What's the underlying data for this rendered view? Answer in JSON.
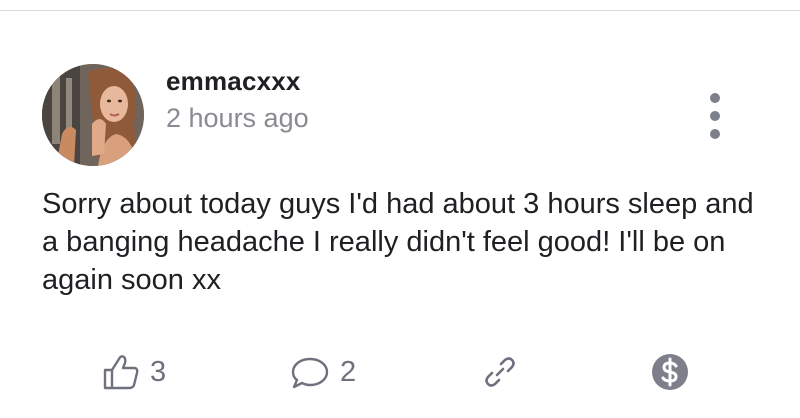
{
  "post": {
    "author": "emmacxxx",
    "time": "2 hours ago",
    "text": "Sorry about today guys I'd had about 3 hours sleep and a banging headache I really didn't feel good! I'll be on again soon xx"
  },
  "actions": {
    "likes": "3",
    "comments": "2"
  },
  "icons": {
    "avatar": "profile-photo",
    "more": "vertical-ellipsis-icon",
    "like": "thumbs-up-icon",
    "comment": "speech-bubble-icon",
    "share": "link-icon",
    "tip": "dollar-coin-icon"
  },
  "colors": {
    "text": "#1f1f24",
    "muted": "#8a8a93",
    "icon": "#6f717c",
    "tip_badge": "#7d7f8b"
  }
}
